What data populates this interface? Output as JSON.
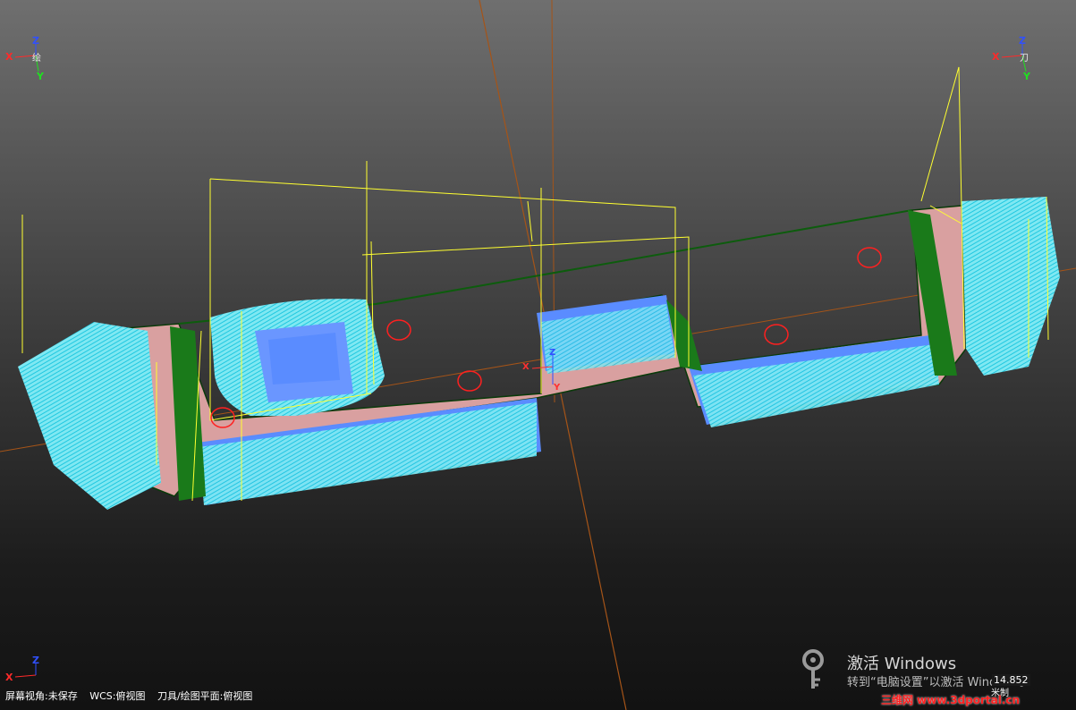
{
  "viewport": {
    "triad_top_left": {
      "x": "X",
      "y": "Y",
      "z": "Z",
      "tag": "绘"
    },
    "triad_top_right": {
      "x": "X",
      "y": "Y",
      "z": "Z",
      "tag": "刀"
    },
    "triad_bottom_left": {
      "x": "X",
      "z": "Z"
    },
    "origin_marker": {
      "x": "X",
      "z": "Z",
      "y": "Y"
    }
  },
  "status_bar": {
    "screen_view": "屏幕视角:未保存",
    "wcs": "WCS:俯视图",
    "tool_plane": "刀具/绘图平面:俯视图"
  },
  "activation_watermark": {
    "title": "激活 Windows",
    "subtitle": "转到“电脑设置”以激活 Windows。"
  },
  "coordinates": {
    "value": "14.852",
    "unit": "米制"
  },
  "brand": {
    "text": "三维网 www.3dportal.cn"
  },
  "colors": {
    "background_top": "#6f6f6f",
    "background_bottom": "#121212",
    "part_top_face": "#d9a0a0",
    "toolpath_cyan": "#30e6f0",
    "wall_green": "#1a7a1a",
    "pocket_blue": "#5a8cff",
    "rapid_moves": "#ffff30",
    "axis_line": "#b85a10"
  }
}
